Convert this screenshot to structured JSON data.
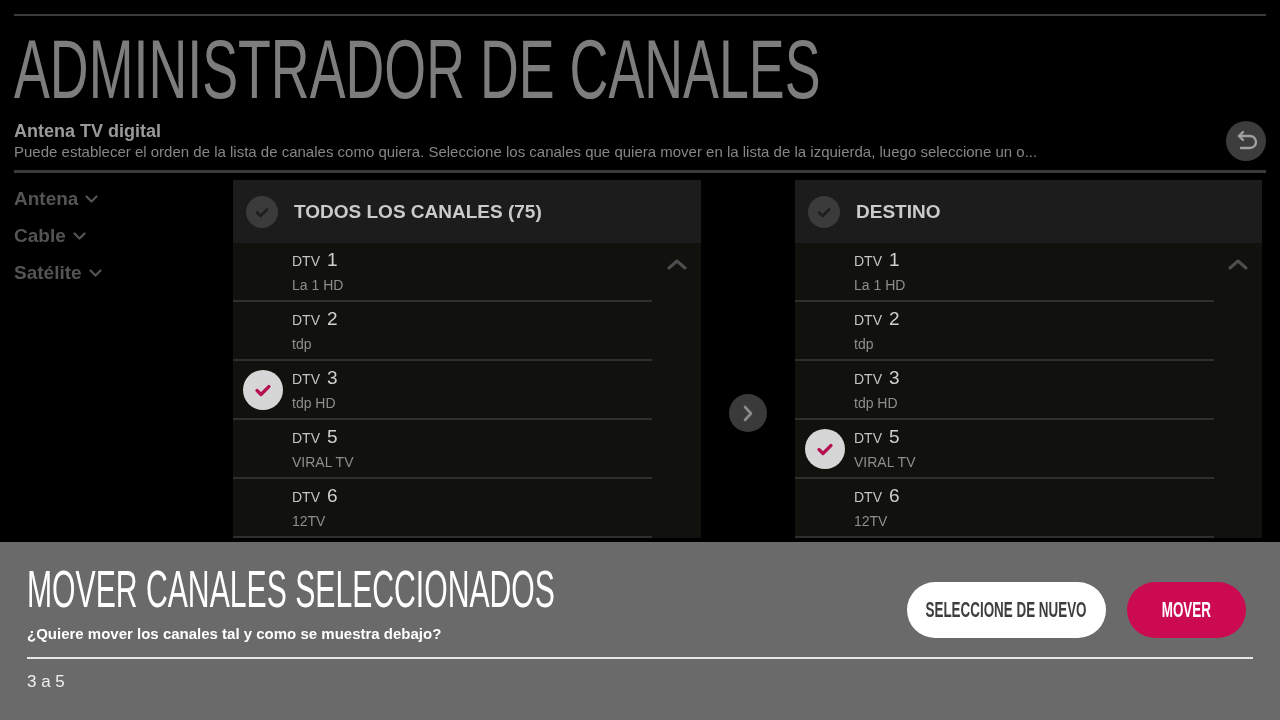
{
  "header": {
    "title": "ADMINISTRADOR DE CANALES",
    "subtitle": "Antena TV digital",
    "description": "Puede establecer el orden de la lista de canales como quiera. Seleccione los canales que quiera mover en la lista de la izquierda, luego seleccione un o..."
  },
  "sidebar": {
    "items": [
      {
        "label": "Antena",
        "expanded": false
      },
      {
        "label": "Cable",
        "expanded": false
      },
      {
        "label": "Satélite",
        "expanded": false
      }
    ]
  },
  "panels": [
    {
      "title": "TODOS LOS CANALES (75)",
      "all_checked": false,
      "channels": [
        {
          "prefix": "DTV",
          "number": "1",
          "name": "La 1 HD",
          "checked": false
        },
        {
          "prefix": "DTV",
          "number": "2",
          "name": "tdp",
          "checked": false
        },
        {
          "prefix": "DTV",
          "number": "3",
          "name": "tdp HD",
          "checked": true
        },
        {
          "prefix": "DTV",
          "number": "5",
          "name": "VIRAL TV",
          "checked": false
        },
        {
          "prefix": "DTV",
          "number": "6",
          "name": "12TV",
          "checked": false
        }
      ]
    },
    {
      "title": "DESTINO",
      "all_checked": false,
      "channels": [
        {
          "prefix": "DTV",
          "number": "1",
          "name": "La 1 HD",
          "checked": false
        },
        {
          "prefix": "DTV",
          "number": "2",
          "name": "tdp",
          "checked": false
        },
        {
          "prefix": "DTV",
          "number": "3",
          "name": "tdp HD",
          "checked": false
        },
        {
          "prefix": "DTV",
          "number": "5",
          "name": "VIRAL TV",
          "checked": true
        },
        {
          "prefix": "DTV",
          "number": "6",
          "name": "12TV",
          "checked": false
        }
      ]
    }
  ],
  "dialog": {
    "title": "MOVER CANALES SELECCIONADOS",
    "question": "¿Quiere mover los canales tal y como se muestra debajo?",
    "buttons": [
      {
        "label": "SELECCIONE DE NUEVO",
        "kind": "secondary"
      },
      {
        "label": "MOVER",
        "kind": "primary"
      }
    ],
    "summary": "3 a 5"
  }
}
